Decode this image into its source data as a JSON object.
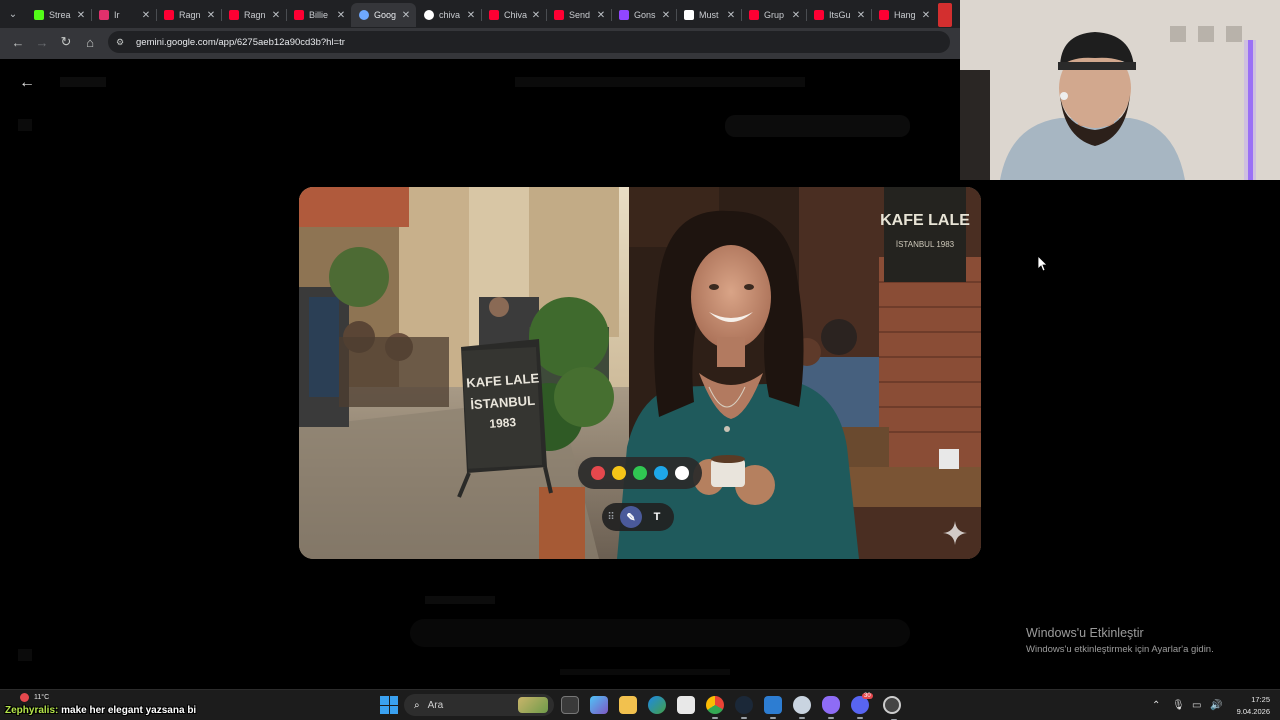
{
  "browser": {
    "tabs": [
      {
        "label": "Strea",
        "favicon": "kick-icon",
        "color": "#53fc18"
      },
      {
        "label": "Ir",
        "favicon": "instagram-icon",
        "color": "#e1306c"
      },
      {
        "label": "Ragn",
        "favicon": "youtube-icon",
        "color": "#ff0033"
      },
      {
        "label": "Ragn",
        "favicon": "youtube-icon",
        "color": "#ff0033"
      },
      {
        "label": "Billie",
        "favicon": "youtube-icon",
        "color": "#ff0033"
      },
      {
        "label": "Goog",
        "favicon": "gemini-icon",
        "color": "#6ea8fe",
        "active": true
      },
      {
        "label": "chiva",
        "favicon": "google-icon",
        "color": "#ffffff"
      },
      {
        "label": "Chiva",
        "favicon": "youtube-icon",
        "color": "#ff0033"
      },
      {
        "label": "Send",
        "favicon": "youtube-icon",
        "color": "#ff0033"
      },
      {
        "label": "Gons",
        "favicon": "twitch-icon",
        "color": "#9146ff"
      },
      {
        "label": "Must",
        "favicon": "tiktok-icon",
        "color": "#ffffff"
      },
      {
        "label": "Grup",
        "favicon": "youtube-icon",
        "color": "#ff0033"
      },
      {
        "label": "ItsGu",
        "favicon": "youtube-icon",
        "color": "#ff0033"
      },
      {
        "label": "Hang",
        "favicon": "youtube-icon",
        "color": "#ff0033"
      }
    ],
    "url": "gemini.google.com/app/6275aeb12a90cd3b?hl=tr"
  },
  "viewer": {
    "sign_board_text": "KAFE LALE",
    "sign_board_sub": "İSTANBUL 1983",
    "a_frame_line1": "KAFE LALE",
    "a_frame_line2": "İSTANBUL",
    "a_frame_line3": "1983",
    "palette": [
      "#e5484d",
      "#f5c518",
      "#30c752",
      "#1ea7e9",
      "#ffffff"
    ],
    "tool_text_label": "T"
  },
  "windows_notice": {
    "title": "Windows'u Etkinleştir",
    "subtitle": "Windows'u etkinleştirmek için Ayarlar'a gidin."
  },
  "taskbar": {
    "weather_temp": "11°C",
    "overlay_prefix": "Zephyralis:",
    "overlay_message": "make her elegant yazsana bi",
    "search_placeholder": "Ara",
    "time": "17:25",
    "date": "9.04.2026",
    "discord_badge": "30"
  }
}
